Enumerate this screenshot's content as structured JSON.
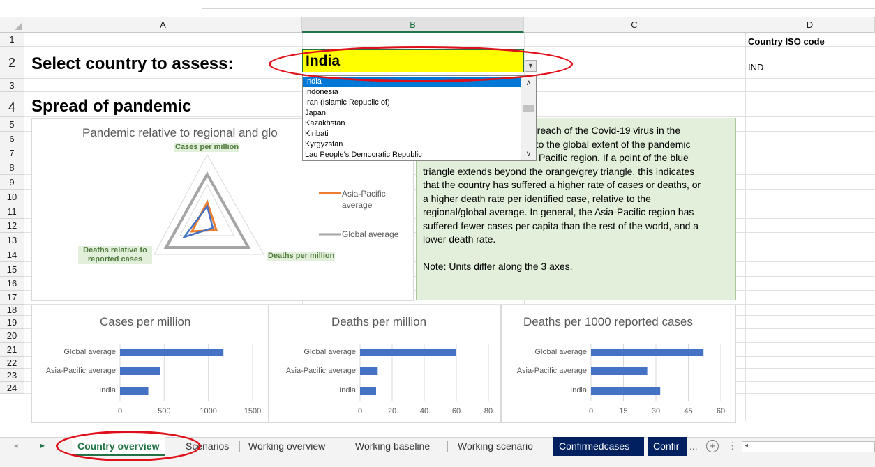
{
  "sheet": {
    "columns": [
      "A",
      "B",
      "C",
      "D"
    ],
    "rows": [
      "1",
      "2",
      "3",
      "4",
      "5",
      "6",
      "7",
      "8",
      "9",
      "10",
      "11",
      "12",
      "13",
      "14",
      "15",
      "16",
      "17",
      "18",
      "19",
      "20",
      "21",
      "22",
      "23",
      "24"
    ],
    "select_label": "Select country to assess:",
    "selected_country": "India",
    "iso_header": "Country ISO code",
    "iso_value": "IND",
    "section_title": "Spread of pandemic"
  },
  "dropdown": {
    "items": [
      "India",
      "Indonesia",
      "Iran (Islamic Republic of)",
      "Japan",
      "Kazakhstan",
      "Kiribati",
      "Kyrgyzstan",
      "Lao People's Democratic Republic"
    ],
    "highlighted_index": 0
  },
  "radar": {
    "title": "Pandemic relative to regional and glo",
    "axis_labels": [
      "Cases per million",
      "Deaths per million",
      "Deaths relative to reported cases"
    ],
    "legend": [
      "Asia-Pacific average",
      "Global average"
    ],
    "series_colors": {
      "country": "#4472c4",
      "asia_pacific": "#ed7d31",
      "global": "#a5a5a5"
    }
  },
  "textbox": {
    "lines": [
      "e reach of the Covid-19 virus in the",
      "e to the global extent of the pandemic",
      "Pacific region. If a point of the blue",
      "triangle extends beyond the orange/grey triangle, this indicates",
      "that the country has suffered a higher rate of cases or deaths, or",
      "a higher death rate per identified case, relative to the",
      "regional/global average. In general, the Asia-Pacific region has",
      "suffered fewer cases per capita than the rest of the world, and a",
      "lower death rate.",
      "",
      "Note: Units differ along the 3 axes."
    ]
  },
  "chart_data": [
    {
      "type": "bar",
      "title": "Cases per million",
      "categories": [
        "Global average",
        "Asia-Pacific average",
        "India"
      ],
      "values": [
        1170,
        450,
        320
      ],
      "xlim": [
        0,
        1500
      ],
      "ticks": [
        "0",
        "500",
        "1000",
        "1500"
      ],
      "color": "#4472c4"
    },
    {
      "type": "bar",
      "title": "Deaths per million",
      "categories": [
        "Global average",
        "Asia-Pacific average",
        "India"
      ],
      "values": [
        60,
        11,
        10
      ],
      "xlim": [
        0,
        80
      ],
      "ticks": [
        "0",
        "20",
        "40",
        "60",
        "80"
      ],
      "color": "#4472c4"
    },
    {
      "type": "bar",
      "title": "Deaths per 1000 reported cases",
      "categories": [
        "Global average",
        "Asia-Pacific average",
        "India"
      ],
      "values": [
        52,
        26,
        32
      ],
      "xlim": [
        0,
        60
      ],
      "ticks": [
        "0",
        "15",
        "30",
        "45",
        "60"
      ],
      "color": "#4472c4"
    }
  ],
  "tabs": {
    "items": [
      "Country overview",
      "Scenarios",
      "Working overview",
      "Working baseline",
      "Working scenario",
      "Confirmedcases",
      "Confir"
    ],
    "active_index": 0,
    "more_label": "...",
    "add_label": "+",
    "nav_label": "▸",
    "options_label": "⋮",
    "scroll_left_label": "◂"
  },
  "annotation_color": "#e0101a"
}
